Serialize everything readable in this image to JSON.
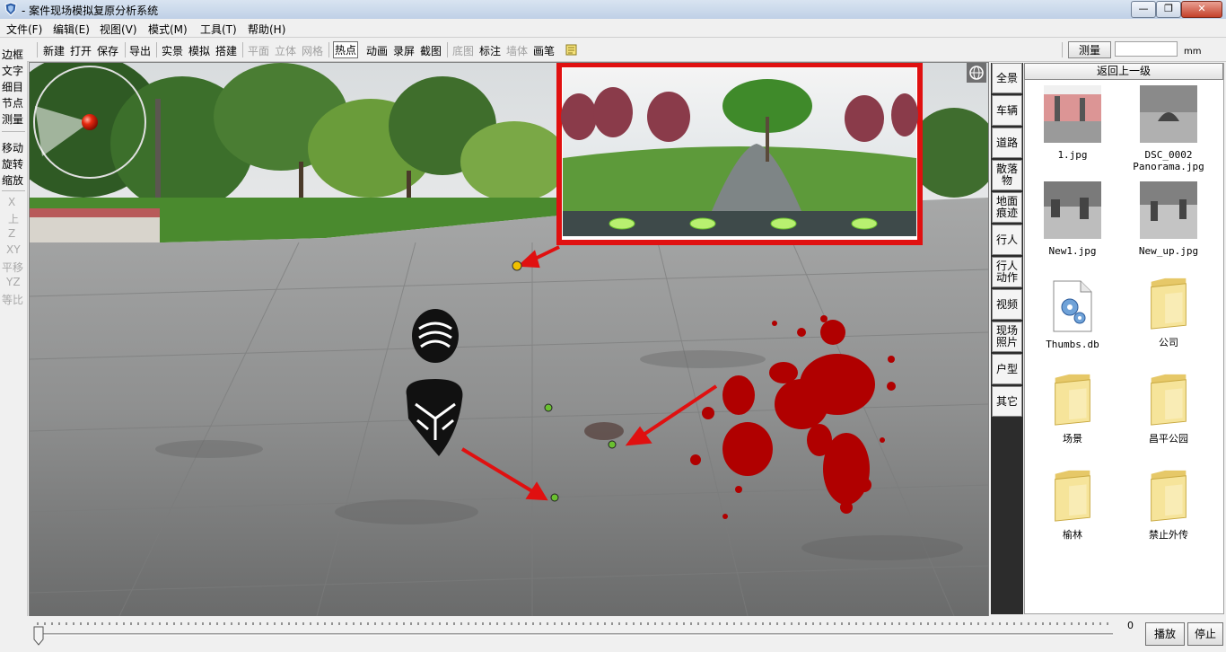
{
  "window": {
    "title": "- 案件现场模拟复原分析系统",
    "controls": [
      "—",
      "❐",
      "✕"
    ]
  },
  "menu": [
    "文件(F)",
    "编辑(E)",
    "视图(V)",
    "模式(M)",
    "工具(T)",
    "帮助(H)"
  ],
  "toolbar": {
    "items": [
      {
        "label": "新建",
        "enabled": true
      },
      {
        "label": "打开",
        "enabled": true
      },
      {
        "label": "保存",
        "enabled": true
      },
      {
        "label": "导出",
        "enabled": true
      },
      {
        "label": "实景",
        "enabled": true
      },
      {
        "label": "模拟",
        "enabled": true
      },
      {
        "label": "搭建",
        "enabled": true
      },
      {
        "label": "平面",
        "enabled": false
      },
      {
        "label": "立体",
        "enabled": false
      },
      {
        "label": "网格",
        "enabled": false
      },
      {
        "label": "热点",
        "enabled": true,
        "selected": true
      },
      {
        "label": "动画",
        "enabled": true
      },
      {
        "label": "录屏",
        "enabled": true
      },
      {
        "label": "截图",
        "enabled": true
      },
      {
        "label": "底图",
        "enabled": false
      },
      {
        "label": "标注",
        "enabled": true
      },
      {
        "label": "墙体",
        "enabled": false
      },
      {
        "label": "画笔",
        "enabled": true
      }
    ],
    "measure_label": "测量",
    "measure_value": "",
    "unit": "mm"
  },
  "left_tools": [
    {
      "label": "边框",
      "enabled": true
    },
    {
      "label": "文字",
      "enabled": true
    },
    {
      "label": "细目",
      "enabled": true
    },
    {
      "label": "节点",
      "enabled": true
    },
    {
      "label": "测量",
      "enabled": true
    },
    {
      "label": "移动",
      "enabled": true
    },
    {
      "label": "旋转",
      "enabled": true
    },
    {
      "label": "缩放",
      "enabled": true
    },
    {
      "label": "X",
      "enabled": false
    },
    {
      "label": "上",
      "enabled": false
    },
    {
      "label": "Z",
      "enabled": false
    },
    {
      "label": "XY",
      "enabled": false
    },
    {
      "label": "平移",
      "enabled": false
    },
    {
      "label": "YZ",
      "enabled": false
    },
    {
      "label": "等比",
      "enabled": false
    }
  ],
  "categories": [
    "全景",
    "车辆",
    "道路",
    "散落物",
    "地面痕迹",
    "行人",
    "行人动作",
    "视频",
    "现场照片",
    "户型",
    "其它"
  ],
  "file_panel": {
    "back_label": "返回上一级",
    "files": [
      {
        "name": "1.jpg",
        "kind": "image"
      },
      {
        "name": "DSC_0002 Panorama.jpg",
        "kind": "image"
      },
      {
        "name": "New1.jpg",
        "kind": "image"
      },
      {
        "name": "New_up.jpg",
        "kind": "image"
      },
      {
        "name": "Thumbs.db",
        "kind": "db"
      },
      {
        "name": "公司",
        "kind": "folder"
      },
      {
        "name": "场景",
        "kind": "folder"
      },
      {
        "name": "昌平公园",
        "kind": "folder"
      },
      {
        "name": "榆林",
        "kind": "folder"
      },
      {
        "name": "禁止外传",
        "kind": "folder"
      }
    ]
  },
  "timeline": {
    "value": "0",
    "position": 0.0
  },
  "buttons": {
    "play": "播放",
    "stop": "停止"
  },
  "colors": {
    "accent_red": "#e01010",
    "blood": "#b00000",
    "titlebar": "#c9d8ec"
  }
}
